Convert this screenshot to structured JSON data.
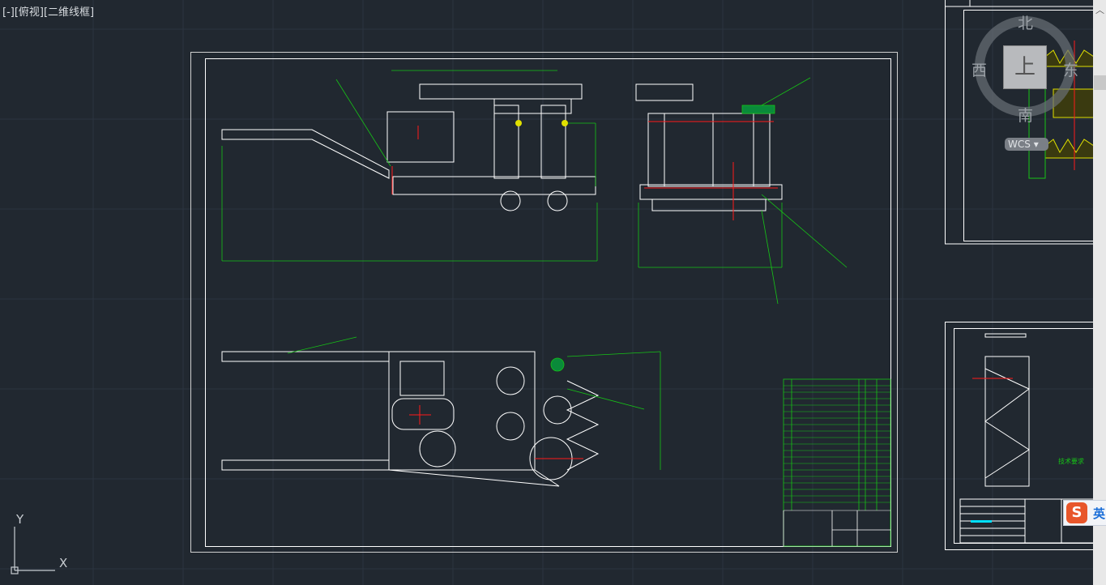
{
  "viewport": {
    "label": "[-][俯视][二维线框]"
  },
  "viewcube": {
    "north": "北",
    "south": "南",
    "east": "东",
    "west": "西",
    "face": "上",
    "coordinate_system": "WCS"
  },
  "ucs": {
    "x_label": "X",
    "y_label": "Y"
  },
  "drawing": {
    "tech_requirements_title": "技术要求"
  },
  "ime": {
    "language": "英",
    "logo": "S"
  },
  "colors": {
    "background": "#212830",
    "lines": "#ffffff",
    "dimensions": "#16c416",
    "centerlines": "#ff1a1a",
    "hatch": "#e0e000",
    "title_cells": "#00e0ff"
  }
}
